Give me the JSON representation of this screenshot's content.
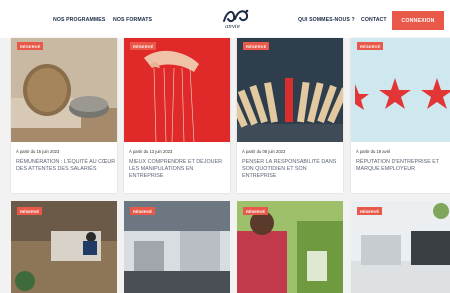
{
  "header": {
    "nav_left": [
      "NOS PROGRAMMES",
      "NOS FORMATS"
    ],
    "logo_text": "anvie",
    "nav_right": [
      "QUI SOMMES-NOUS ?",
      "CONTACT"
    ],
    "cta_label": "CONNEXION"
  },
  "colors": {
    "accent": "#e8594a",
    "nav": "#1b2a47",
    "card_title": "#5a6476"
  },
  "cards": [
    {
      "badge": "RÉSERVÉ",
      "date": "À partir du 15 juin 2023",
      "title": "RÉMUNÉRATION : L'ÉQUITÉ AU CŒUR DES ATTENTES DES SALARIÉS"
    },
    {
      "badge": "RÉSERVÉ",
      "date": "À partir du 13 juin 2023",
      "title": "MIEUX COMPRENDRE ET DÉJOUER LES MANIPULATIONS EN ENTREPRISE"
    },
    {
      "badge": "RÉSERVÉ",
      "date": "À partir du 08 juin 2023",
      "title": "PENSER LA RESPONSABILITÉ DANS SON QUOTIDIEN ET SON ENTREPRISE"
    },
    {
      "badge": "RÉSERVÉ",
      "date": "À partir du 19 avril",
      "title": "RÉPUTATION D'ENTREPRISE ET MARQUE EMPLOYEUR"
    }
  ],
  "cards_row2": [
    {
      "badge": "RÉSERVÉ"
    },
    {
      "badge": "RÉSERVÉ"
    },
    {
      "badge": "RÉSERVÉ"
    },
    {
      "badge": "RÉSERVÉ"
    }
  ]
}
